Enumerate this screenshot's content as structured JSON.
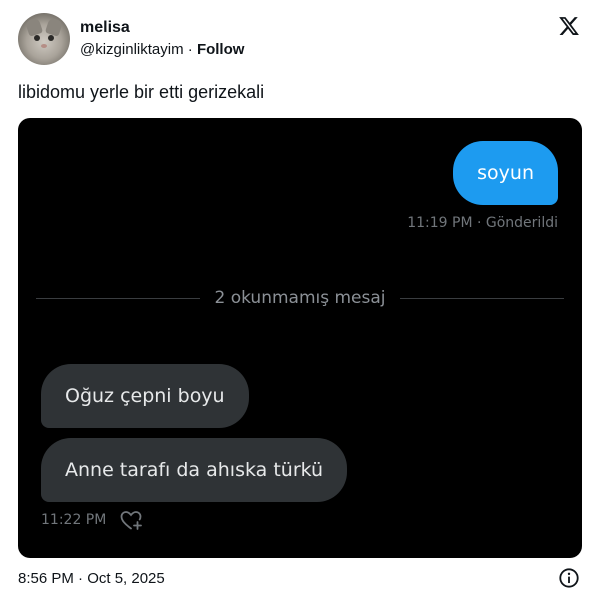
{
  "author": {
    "name": "melisa",
    "handle": "@kizginliktayim",
    "separator": "·",
    "follow_label": "Follow"
  },
  "platform_icon": "x-logo-icon",
  "tweet_text": "libidomu yerle bir etti gerizekali",
  "dm": {
    "sent": {
      "text": "soyun",
      "meta": "11:19 PM · Gönderildi"
    },
    "divider_label": "2 okunmamış mesaj",
    "received": [
      {
        "text": "Oğuz çepni boyu"
      },
      {
        "text": "Anne tarafı da ahıska türkü"
      }
    ],
    "received_time": "11:22 PM",
    "react_icon": "heart-plus-icon"
  },
  "footer": {
    "timestamp": "8:56 PM · Oct 5, 2025",
    "info_icon": "info-icon"
  },
  "colors": {
    "sent_bubble": "#1d9bf0",
    "received_bubble": "#2f3336",
    "media_bg": "#000000"
  }
}
